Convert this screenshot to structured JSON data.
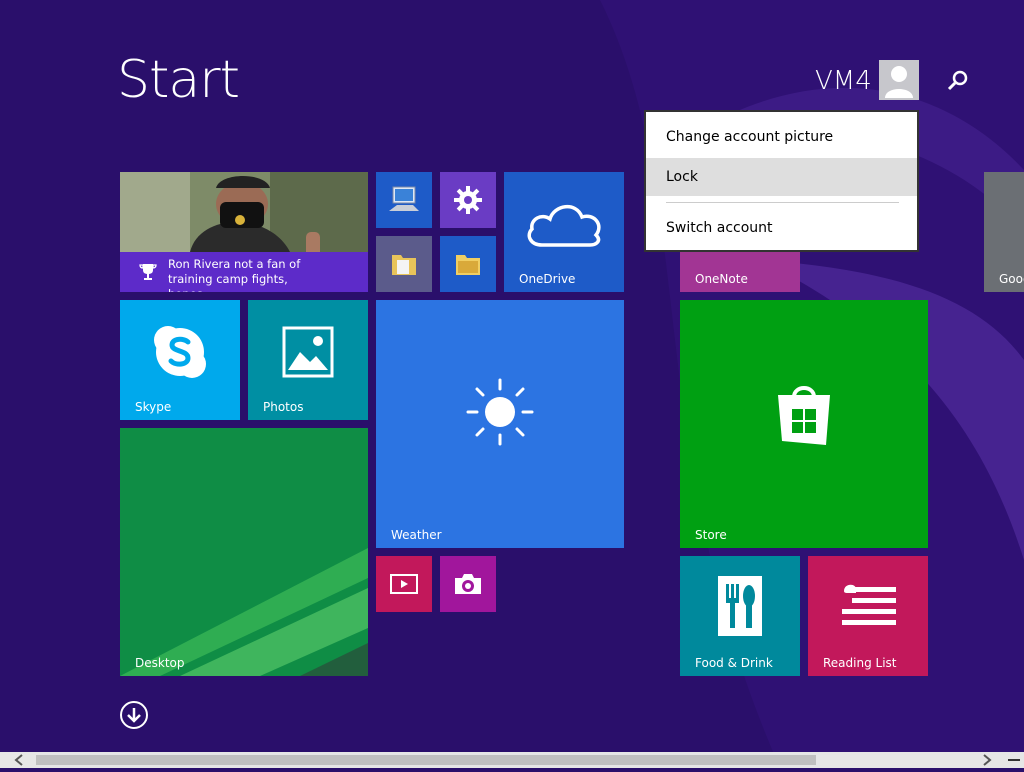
{
  "header": {
    "title": "Start",
    "user_name": "VM4"
  },
  "account_menu": {
    "items": [
      {
        "label": "Change account picture"
      },
      {
        "label": "Lock"
      },
      {
        "label": "Switch account"
      }
    ]
  },
  "tiles": {
    "news_headline": "Ron Rivera not a fan of training camp fights, hopes...",
    "onedrive": "OneDrive",
    "onenote": "OneNote",
    "google_partial": "Goog",
    "skype": "Skype",
    "photos": "Photos",
    "weather": "Weather",
    "store": "Store",
    "desktop": "Desktop",
    "food_drink": "Food & Drink",
    "reading_list": "Reading List"
  },
  "icons": {
    "search": "search-icon",
    "avatar": "user-avatar-icon",
    "scroll_down": "arrow-down-circle-icon"
  },
  "colors": {
    "background": "#2a0f6b",
    "news_banner": "#5d2bc9",
    "onedrive": "#1e5bc8",
    "skype": "#00a9ec",
    "photos": "#008fa3",
    "weather": "#2c74e2",
    "store": "#00a012",
    "desktop": "#0e8f43",
    "food_drink": "#00899c",
    "reading_list": "#c2185b",
    "onenote": "#a23594"
  }
}
